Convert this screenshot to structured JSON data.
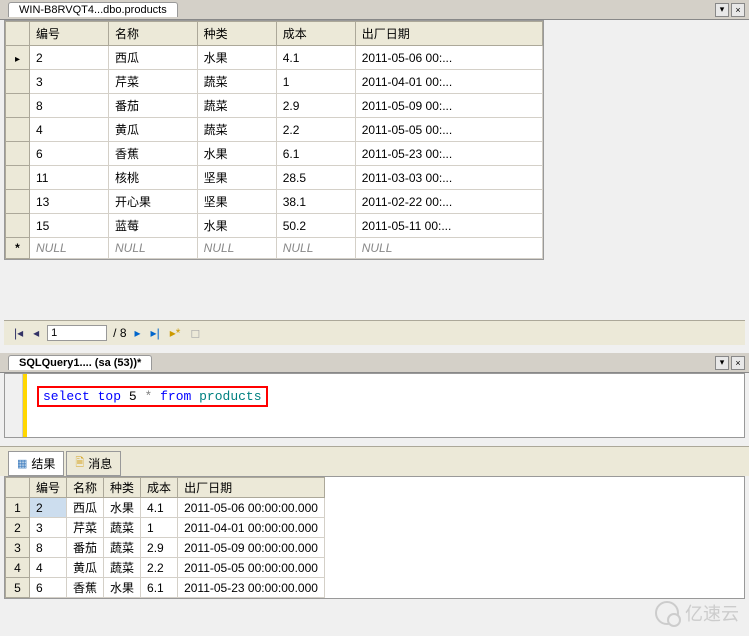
{
  "top_tab": "WIN-B8RVQT4...dbo.products",
  "grid": {
    "columns": [
      "编号",
      "名称",
      "种类",
      "成本",
      "出厂日期"
    ],
    "rows": [
      [
        "2",
        "西瓜",
        "水果",
        "4.1",
        "2011-05-06 00:..."
      ],
      [
        "3",
        "芹菜",
        "蔬菜",
        "1",
        "2011-04-01 00:..."
      ],
      [
        "8",
        "番茄",
        "蔬菜",
        "2.9",
        "2011-05-09 00:..."
      ],
      [
        "4",
        "黄瓜",
        "蔬菜",
        "2.2",
        "2011-05-05 00:..."
      ],
      [
        "6",
        "香蕉",
        "水果",
        "6.1",
        "2011-05-23 00:..."
      ],
      [
        "11",
        "核桃",
        "坚果",
        "28.5",
        "2011-03-03 00:..."
      ],
      [
        "13",
        "开心果",
        "坚果",
        "38.1",
        "2011-02-22 00:..."
      ],
      [
        "15",
        "蓝莓",
        "水果",
        "50.2",
        "2011-05-11 00:..."
      ]
    ],
    "null_label": "NULL"
  },
  "nav": {
    "current": "1",
    "total": "/ 8"
  },
  "sql_tab": "SQLQuery1.... (sa (53))*",
  "sql": {
    "select": "select",
    "top": "top",
    "num": "5",
    "star": "*",
    "from": "from",
    "table": "products"
  },
  "results_tabs": {
    "results": "结果",
    "messages": "消息"
  },
  "results": {
    "columns": [
      "编号",
      "名称",
      "种类",
      "成本",
      "出厂日期"
    ],
    "rows": [
      [
        "2",
        "西瓜",
        "水果",
        "4.1",
        "2011-05-06 00:00:00.000"
      ],
      [
        "3",
        "芹菜",
        "蔬菜",
        "1",
        "2011-04-01 00:00:00.000"
      ],
      [
        "8",
        "番茄",
        "蔬菜",
        "2.9",
        "2011-05-09 00:00:00.000"
      ],
      [
        "4",
        "黄瓜",
        "蔬菜",
        "2.2",
        "2011-05-05 00:00:00.000"
      ],
      [
        "6",
        "香蕉",
        "水果",
        "6.1",
        "2011-05-23 00:00:00.000"
      ]
    ]
  },
  "watermark": "亿速云"
}
